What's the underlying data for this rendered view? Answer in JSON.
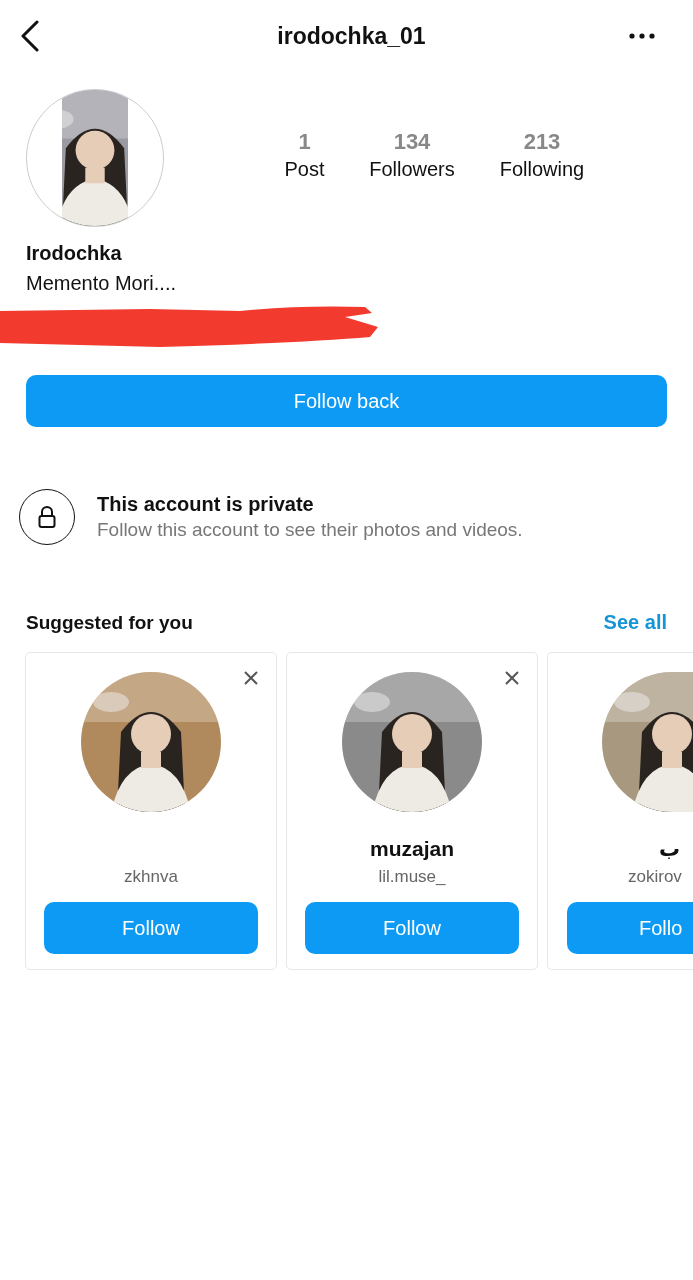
{
  "header": {
    "title": "irodochka_01"
  },
  "profile": {
    "stats": [
      {
        "value": "1",
        "label": "Post"
      },
      {
        "value": "134",
        "label": "Followers"
      },
      {
        "value": "213",
        "label": "Following"
      }
    ],
    "name": "Irodochka",
    "bio": "Memento Mori....",
    "redacted": true
  },
  "follow_button": "Follow back",
  "private_notice": {
    "title": "This account is private",
    "text": "Follow this account to see their photos and videos."
  },
  "suggested": {
    "title": "Suggested for you",
    "see_all": "See all",
    "cards": [
      {
        "kind": "full",
        "dismiss": true,
        "handle": "zkhnva",
        "button": "Follow"
      },
      {
        "kind": "full",
        "dismiss": true,
        "name": "muzajan",
        "handle": "lil.muse_",
        "button": "Follow"
      },
      {
        "kind": "cut",
        "dismiss": false,
        "name": "ب",
        "handle": "zokirov",
        "button": "Follo"
      }
    ]
  }
}
